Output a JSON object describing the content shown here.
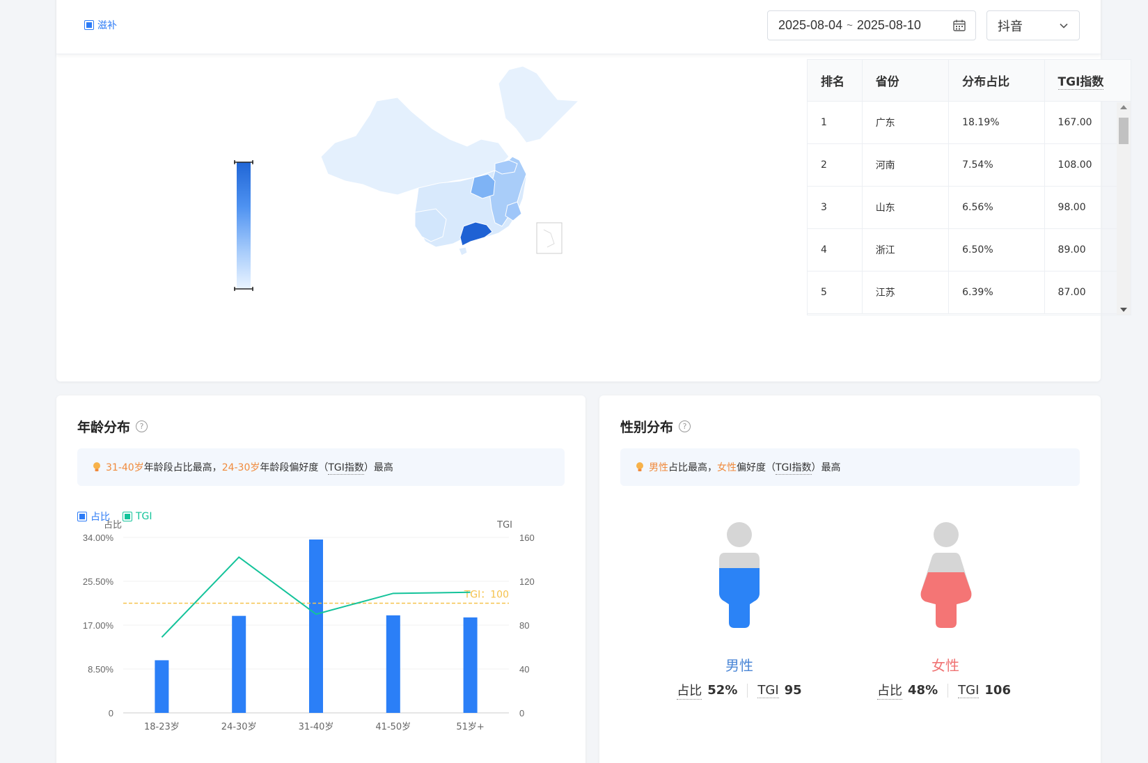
{
  "header": {
    "supplement_label": "滋补",
    "date_start": "2025-08-04",
    "date_sep": "~",
    "date_end": "2025-08-10",
    "platform": "抖音"
  },
  "province_table": {
    "headers": [
      "排名",
      "省份",
      "分布占比",
      "TGI指数"
    ],
    "rows": [
      {
        "rank": "1",
        "province": "广东",
        "share": "18.19%",
        "tgi": "167.00"
      },
      {
        "rank": "2",
        "province": "河南",
        "share": "7.54%",
        "tgi": "108.00"
      },
      {
        "rank": "3",
        "province": "山东",
        "share": "6.56%",
        "tgi": "98.00"
      },
      {
        "rank": "4",
        "province": "浙江",
        "share": "6.50%",
        "tgi": "89.00"
      },
      {
        "rank": "5",
        "province": "江苏",
        "share": "6.39%",
        "tgi": "87.00"
      }
    ]
  },
  "age": {
    "title": "年龄分布",
    "tip": {
      "highlight1": "31-40岁",
      "text1": "年龄段占比最高，",
      "highlight2": "24-30岁",
      "text2": "年龄段偏好度（",
      "tgi_term": "TGI指数",
      "text3": "）最高"
    },
    "legend": {
      "share": "占比",
      "tgi": "TGI"
    }
  },
  "gender": {
    "title": "性别分布",
    "tip": {
      "highlight1": "男性",
      "text1": "占比最高，",
      "highlight2": "女性",
      "text2": "偏好度（",
      "tgi_term": "TGI指数",
      "text3": "）最高"
    },
    "male": {
      "label": "男性",
      "share_label": "占比",
      "share": "52%",
      "tgi_label": "TGI",
      "tgi": "95",
      "color": "#2b83f6"
    },
    "female": {
      "label": "女性",
      "share_label": "占比",
      "share": "48%",
      "tgi_label": "TGI",
      "tgi": "106",
      "color": "#f47575"
    }
  },
  "chart_data": {
    "type": "bar",
    "categories": [
      "18-23岁",
      "24-30岁",
      "31-40岁",
      "41-50岁",
      "51岁+"
    ],
    "series": [
      {
        "name": "占比",
        "type": "bar",
        "axis": "left",
        "values": [
          10.2,
          18.8,
          33.6,
          18.9,
          18.5
        ],
        "color": "#2b7ff7"
      },
      {
        "name": "TGI",
        "type": "line",
        "axis": "right",
        "values": [
          69,
          142,
          90,
          109,
          110
        ],
        "color": "#14c39a"
      }
    ],
    "ylabel_left": "占比",
    "ylabel_right": "TGI",
    "yticks_left": [
      "0",
      "8.50%",
      "17.00%",
      "25.50%",
      "34.00%"
    ],
    "yticks_right": [
      "0",
      "40",
      "80",
      "120",
      "160"
    ],
    "ylim_left": [
      0,
      34
    ],
    "ylim_right": [
      0,
      160
    ],
    "reference_line": {
      "value": 100,
      "label": "TGI：100",
      "color": "#f5c24c"
    }
  }
}
